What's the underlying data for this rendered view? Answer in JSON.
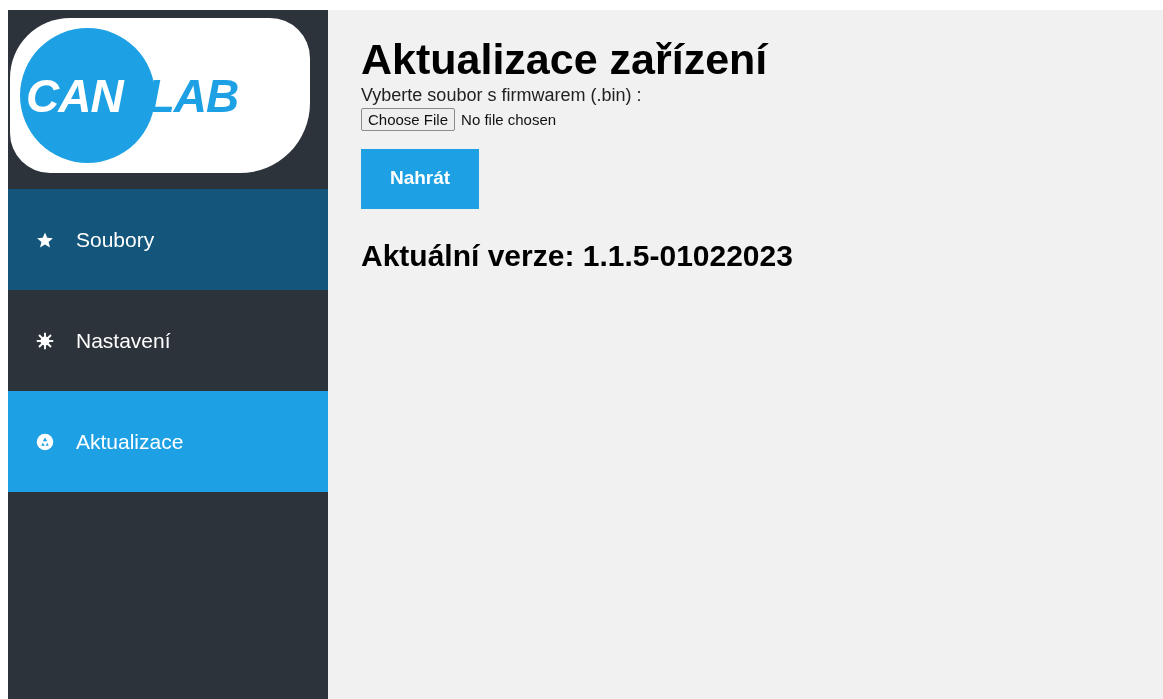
{
  "logo": {
    "left": "CAN",
    "right": "LAB"
  },
  "sidebar": {
    "items": [
      {
        "label": "Soubory",
        "selected": false,
        "highlighted": true
      },
      {
        "label": "Nastavení",
        "selected": false,
        "highlighted": false
      },
      {
        "label": "Aktualizace",
        "selected": true
      }
    ]
  },
  "main": {
    "title": "Aktualizace zařízení",
    "file_label": "Vyberte soubor s firmwarem (.bin) :",
    "file_button": "Choose File",
    "file_status": "No file chosen",
    "upload_button": "Nahrát",
    "version": "Aktuální verze: 1.1.5-01022023"
  }
}
